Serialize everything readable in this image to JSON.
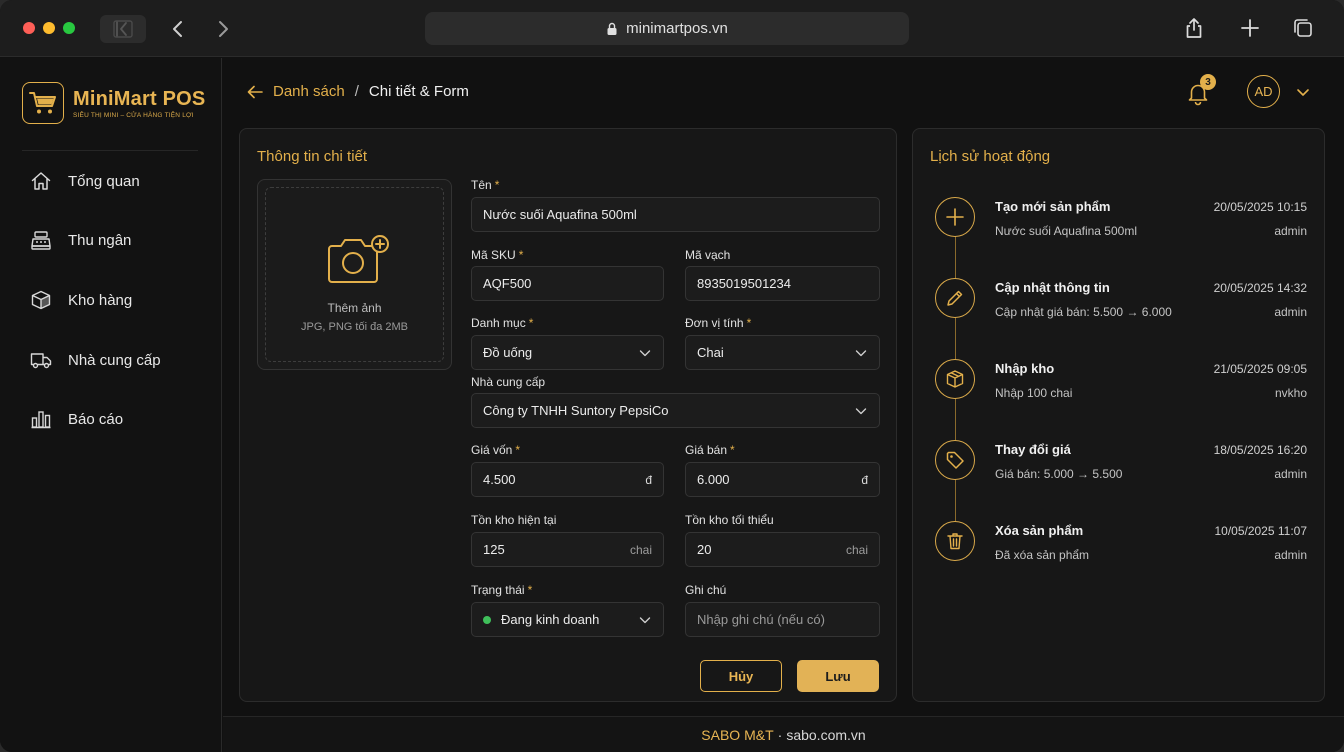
{
  "browser": {
    "url": "minimartpos.vn"
  },
  "sidebar": {
    "logo_title": "MiniMart POS",
    "logo_subtitle": "SIÊU THỊ MINI – CỬA HÀNG TIỆN LỢI",
    "items": [
      {
        "label": "Tổng quan",
        "icon": "home-icon"
      },
      {
        "label": "Thu ngân",
        "icon": "cash-register-icon"
      },
      {
        "label": "Kho hàng",
        "icon": "box-icon"
      },
      {
        "label": "Nhà cung cấp",
        "icon": "truck-icon"
      },
      {
        "label": "Báo cáo",
        "icon": "bar-chart-icon"
      }
    ]
  },
  "header": {
    "breadcrumb_back": "Danh sách",
    "breadcrumb_sep": "/",
    "breadcrumb_current": "Chi tiết & Form",
    "notification_count": "3",
    "avatar_initials": "AD"
  },
  "form": {
    "title": "Thông tin chi tiết",
    "upload": {
      "title": "Thêm ảnh",
      "hint": "JPG, PNG tối đa 2MB"
    },
    "name": {
      "label": "Tên",
      "value": "Nước suối Aquafina 500ml"
    },
    "sku": {
      "label": "Mã SKU",
      "value": "AQF500"
    },
    "barcode": {
      "label": "Mã vạch",
      "value": "8935019501234"
    },
    "category": {
      "label": "Danh mục",
      "value": "Đồ uống"
    },
    "unit": {
      "label": "Đơn vị tính",
      "value": "Chai"
    },
    "supplier": {
      "label": "Nhà cung cấp",
      "value": "Công ty TNHH Suntory PepsiCo"
    },
    "cost_price": {
      "label": "Giá vốn",
      "value": "4.500",
      "unit": "đ"
    },
    "sale_price": {
      "label": "Giá bán",
      "value": "6.000",
      "unit": "đ"
    },
    "stock_current": {
      "label": "Tồn kho hiện tại",
      "value": "125",
      "unit": "chai"
    },
    "stock_min": {
      "label": "Tồn kho tối thiểu",
      "value": "20",
      "unit": "chai"
    },
    "status": {
      "label": "Trạng thái",
      "value": "Đang kinh doanh",
      "color": "#3fbf5a"
    },
    "note": {
      "label": "Ghi chú",
      "placeholder": "Nhập ghi chú (nếu có)"
    },
    "required_mark": "*",
    "cancel_label": "Hủy",
    "save_label": "Lưu"
  },
  "history": {
    "title": "Lịch sử hoạt động",
    "items": [
      {
        "title": "Tạo mới sản phẩm",
        "time": "20/05/2025 10:15",
        "desc": "Nước suối Aquafina 500ml",
        "user": "admin",
        "icon": "plus-icon"
      },
      {
        "title": "Cập nhật thông tin",
        "time": "20/05/2025 14:32",
        "desc": "Cập nhật giá bán: 5.500 → 6.000",
        "user": "admin",
        "icon": "pencil-icon"
      },
      {
        "title": "Nhập kho",
        "time": "21/05/2025 09:05",
        "desc": "Nhập 100 chai",
        "user": "nvkho",
        "icon": "box-icon"
      },
      {
        "title": "Thay đổi giá",
        "time": "18/05/2025 16:20",
        "desc": "Giá bán: 5.000 → 5.500",
        "user": "admin",
        "icon": "price-tag-icon"
      },
      {
        "title": "Xóa sản phẩm",
        "time": "10/05/2025 11:07",
        "desc": "Đã xóa sản phẩm",
        "user": "admin",
        "icon": "trash-icon"
      }
    ]
  },
  "footer": {
    "brand": "SABO M&T",
    "separator": "·",
    "site": "sabo.com.vn"
  },
  "colors": {
    "accent": "#e3b04b",
    "status_active": "#3fbf5a"
  }
}
